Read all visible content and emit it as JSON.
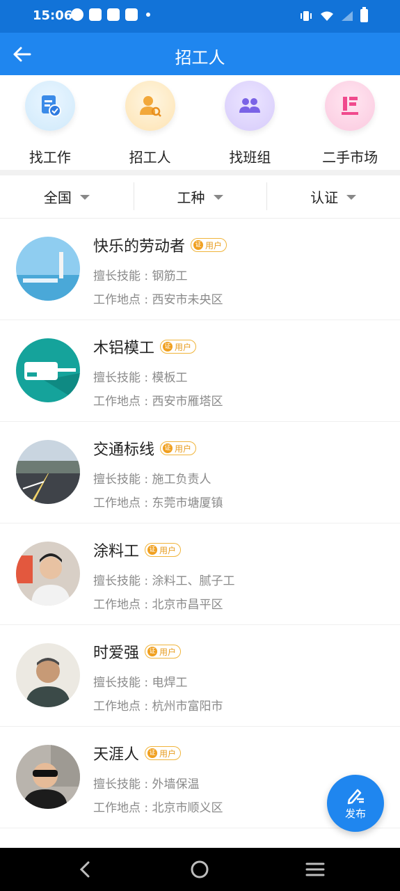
{
  "status_bar": {
    "time": "15:06"
  },
  "app_bar": {
    "title": "招工人"
  },
  "categories": [
    {
      "label": "找工作",
      "icon": "find-job-icon"
    },
    {
      "label": "招工人",
      "icon": "recruit-icon"
    },
    {
      "label": "找班组",
      "icon": "team-icon"
    },
    {
      "label": "二手市场",
      "icon": "market-icon"
    }
  ],
  "filters": [
    {
      "label": "全国"
    },
    {
      "label": "工种"
    },
    {
      "label": "认证"
    }
  ],
  "badge_text": "用户",
  "badge_icon_text": "证",
  "workers": [
    {
      "name": "快乐的劳动者",
      "skill": "擅长技能 : 钢筋工",
      "location": "工作地点 : 西安市未央区"
    },
    {
      "name": "木铝模工",
      "skill": "擅长技能 : 模板工",
      "location": "工作地点 : 西安市雁塔区"
    },
    {
      "name": "交通标线",
      "skill": "擅长技能 : 施工负责人",
      "location": "工作地点 : 东莞市塘厦镇"
    },
    {
      "name": "涂料工",
      "skill": "擅长技能 : 涂料工、腻子工",
      "location": "工作地点 : 北京市昌平区"
    },
    {
      "name": "时爱强",
      "skill": "擅长技能 : 电焊工",
      "location": "工作地点 : 杭州市富阳市"
    },
    {
      "name": "天涯人",
      "skill": "擅长技能 : 外墙保温",
      "location": "工作地点 : 北京市顺义区"
    }
  ],
  "fab": {
    "label": "发布"
  },
  "colors": {
    "primary": "#1f86ef",
    "status_bar": "#1273d8",
    "badge": "#f0a020"
  }
}
